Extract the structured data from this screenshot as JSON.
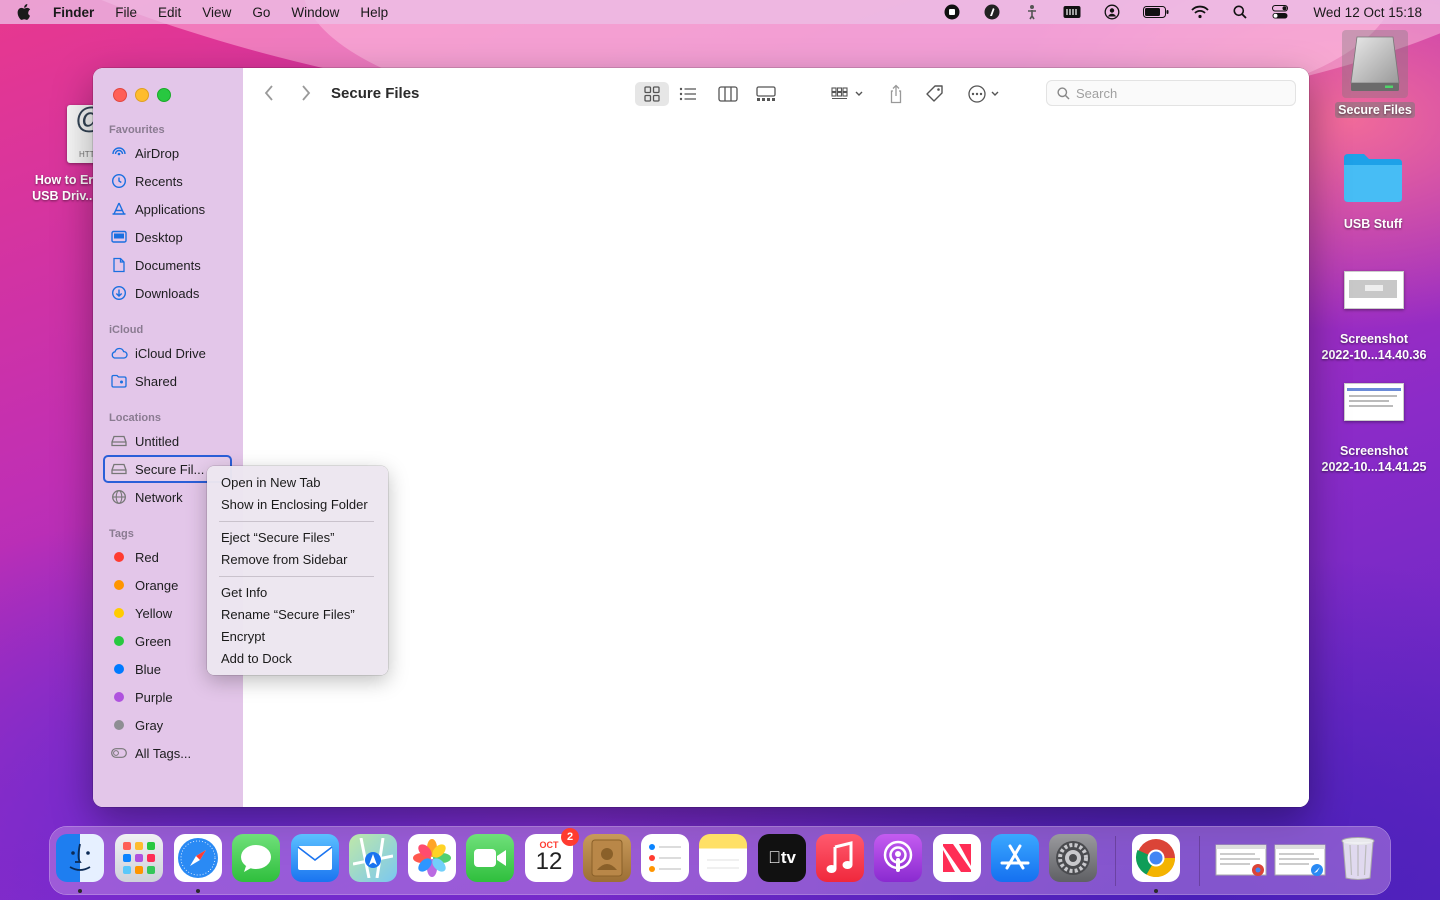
{
  "menubar": {
    "app": "Finder",
    "items": [
      "File",
      "Edit",
      "View",
      "Go",
      "Window",
      "Help"
    ],
    "clock": "Wed 12 Oct  15:18"
  },
  "desktop": {
    "left_item": {
      "label_line1": "How to Er",
      "label_line2": "USB Driv...",
      "thumb_text": "HTT"
    },
    "items": [
      {
        "label": "Secure Files",
        "selected": true,
        "icon": "external-drive-icon"
      },
      {
        "label": "USB Stuff",
        "icon": "folder-icon"
      },
      {
        "label_line1": "Screenshot",
        "label_line2": "2022-10...14.40.36",
        "icon": "screenshot-thumbnail"
      },
      {
        "label_line1": "Screenshot",
        "label_line2": "2022-10...14.41.25",
        "icon": "screenshot-thumbnail"
      }
    ]
  },
  "finder": {
    "title": "Secure Files",
    "search_placeholder": "Search",
    "sidebar": {
      "favourites_heading": "Favourites",
      "favourites": [
        "AirDrop",
        "Recents",
        "Applications",
        "Desktop",
        "Documents",
        "Downloads"
      ],
      "icloud_heading": "iCloud",
      "icloud": [
        "iCloud Drive",
        "Shared"
      ],
      "locations_heading": "Locations",
      "locations": [
        "Untitled",
        "Secure Fil...",
        "Network"
      ],
      "tags_heading": "Tags",
      "tags": [
        {
          "label": "Red",
          "color": "#ff3b30"
        },
        {
          "label": "Orange",
          "color": "#ff9500"
        },
        {
          "label": "Yellow",
          "color": "#ffcc00"
        },
        {
          "label": "Green",
          "color": "#28c840"
        },
        {
          "label": "Blue",
          "color": "#007aff"
        },
        {
          "label": "Purple",
          "color": "#af52de"
        },
        {
          "label": "Gray",
          "color": "#8e8e93"
        }
      ],
      "all_tags": "All Tags..."
    }
  },
  "context_menu": {
    "items": [
      "Open in New Tab",
      "Show in Enclosing Folder",
      "Eject “Secure Files”",
      "Remove from Sidebar",
      "Get Info",
      "Rename “Secure Files”",
      "Encrypt",
      "Add to Dock"
    ]
  },
  "dock": {
    "calendar_month": "OCT",
    "calendar_day": "12",
    "calendar_badge": "2",
    "apps": [
      "Finder",
      "Launchpad",
      "Safari",
      "Messages",
      "Mail",
      "Maps",
      "Photos",
      "FaceTime",
      "Calendar",
      "Contacts",
      "Reminders",
      "Notes",
      "TV",
      "Music",
      "Podcasts",
      "News",
      "App Store",
      "System Preferences",
      "Chrome"
    ]
  },
  "colors": {
    "accent": "#1a6fe0",
    "selection_border": "#2a5fd8"
  }
}
